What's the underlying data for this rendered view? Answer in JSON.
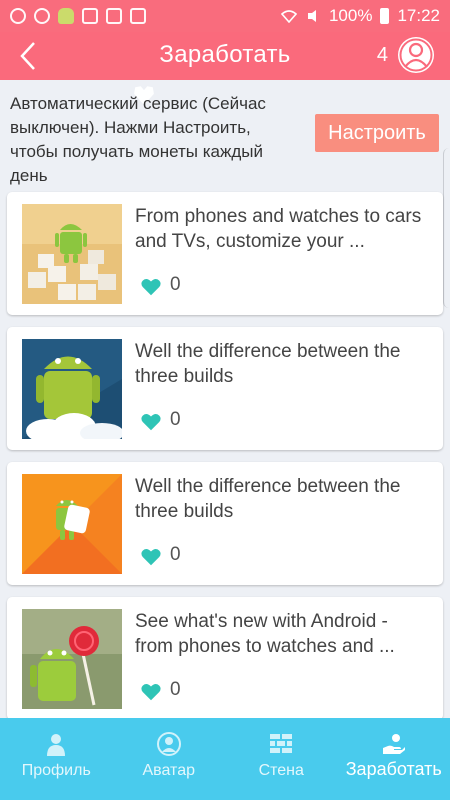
{
  "status_bar": {
    "battery": "100%",
    "time": "17:22",
    "icons": [
      "signal-icon",
      "shield-icon",
      "heart-icon",
      "android-icon",
      "mail-icon",
      "image-icon",
      "bag-icon",
      "wifi-icon",
      "mute-icon",
      "battery-icon"
    ]
  },
  "app_bar": {
    "title": "Заработать",
    "coins": "4",
    "accent": "#fa6a7c"
  },
  "service": {
    "text": "Автоматический сервис (Сейчас выключен). Нажми Настроить, чтобы получать монеты каждый день",
    "button_label": "Настроить",
    "button_color": "#f98e7f"
  },
  "cards": [
    {
      "title": "From phones and watches to cars and TVs, customize your ...",
      "likes": "0",
      "thumb": "android-marshmallow-cubes"
    },
    {
      "title": "Well the difference between the three builds",
      "likes": "0",
      "thumb": "android-blue-clouds"
    },
    {
      "title": "Well the difference between the three builds",
      "likes": "0",
      "thumb": "android-orange-marshmallow"
    },
    {
      "title": "See what's new with Android - from phones to watches and ...",
      "likes": "0",
      "thumb": "android-lollipop"
    }
  ],
  "bottom_nav": {
    "color": "#49cbed",
    "items": [
      {
        "label": "Профиль",
        "icon": "person-icon"
      },
      {
        "label": "Аватар",
        "icon": "avatar-icon"
      },
      {
        "label": "Стена",
        "icon": "wall-icon"
      },
      {
        "label": "Заработать",
        "icon": "earn-icon",
        "active": true
      }
    ]
  }
}
